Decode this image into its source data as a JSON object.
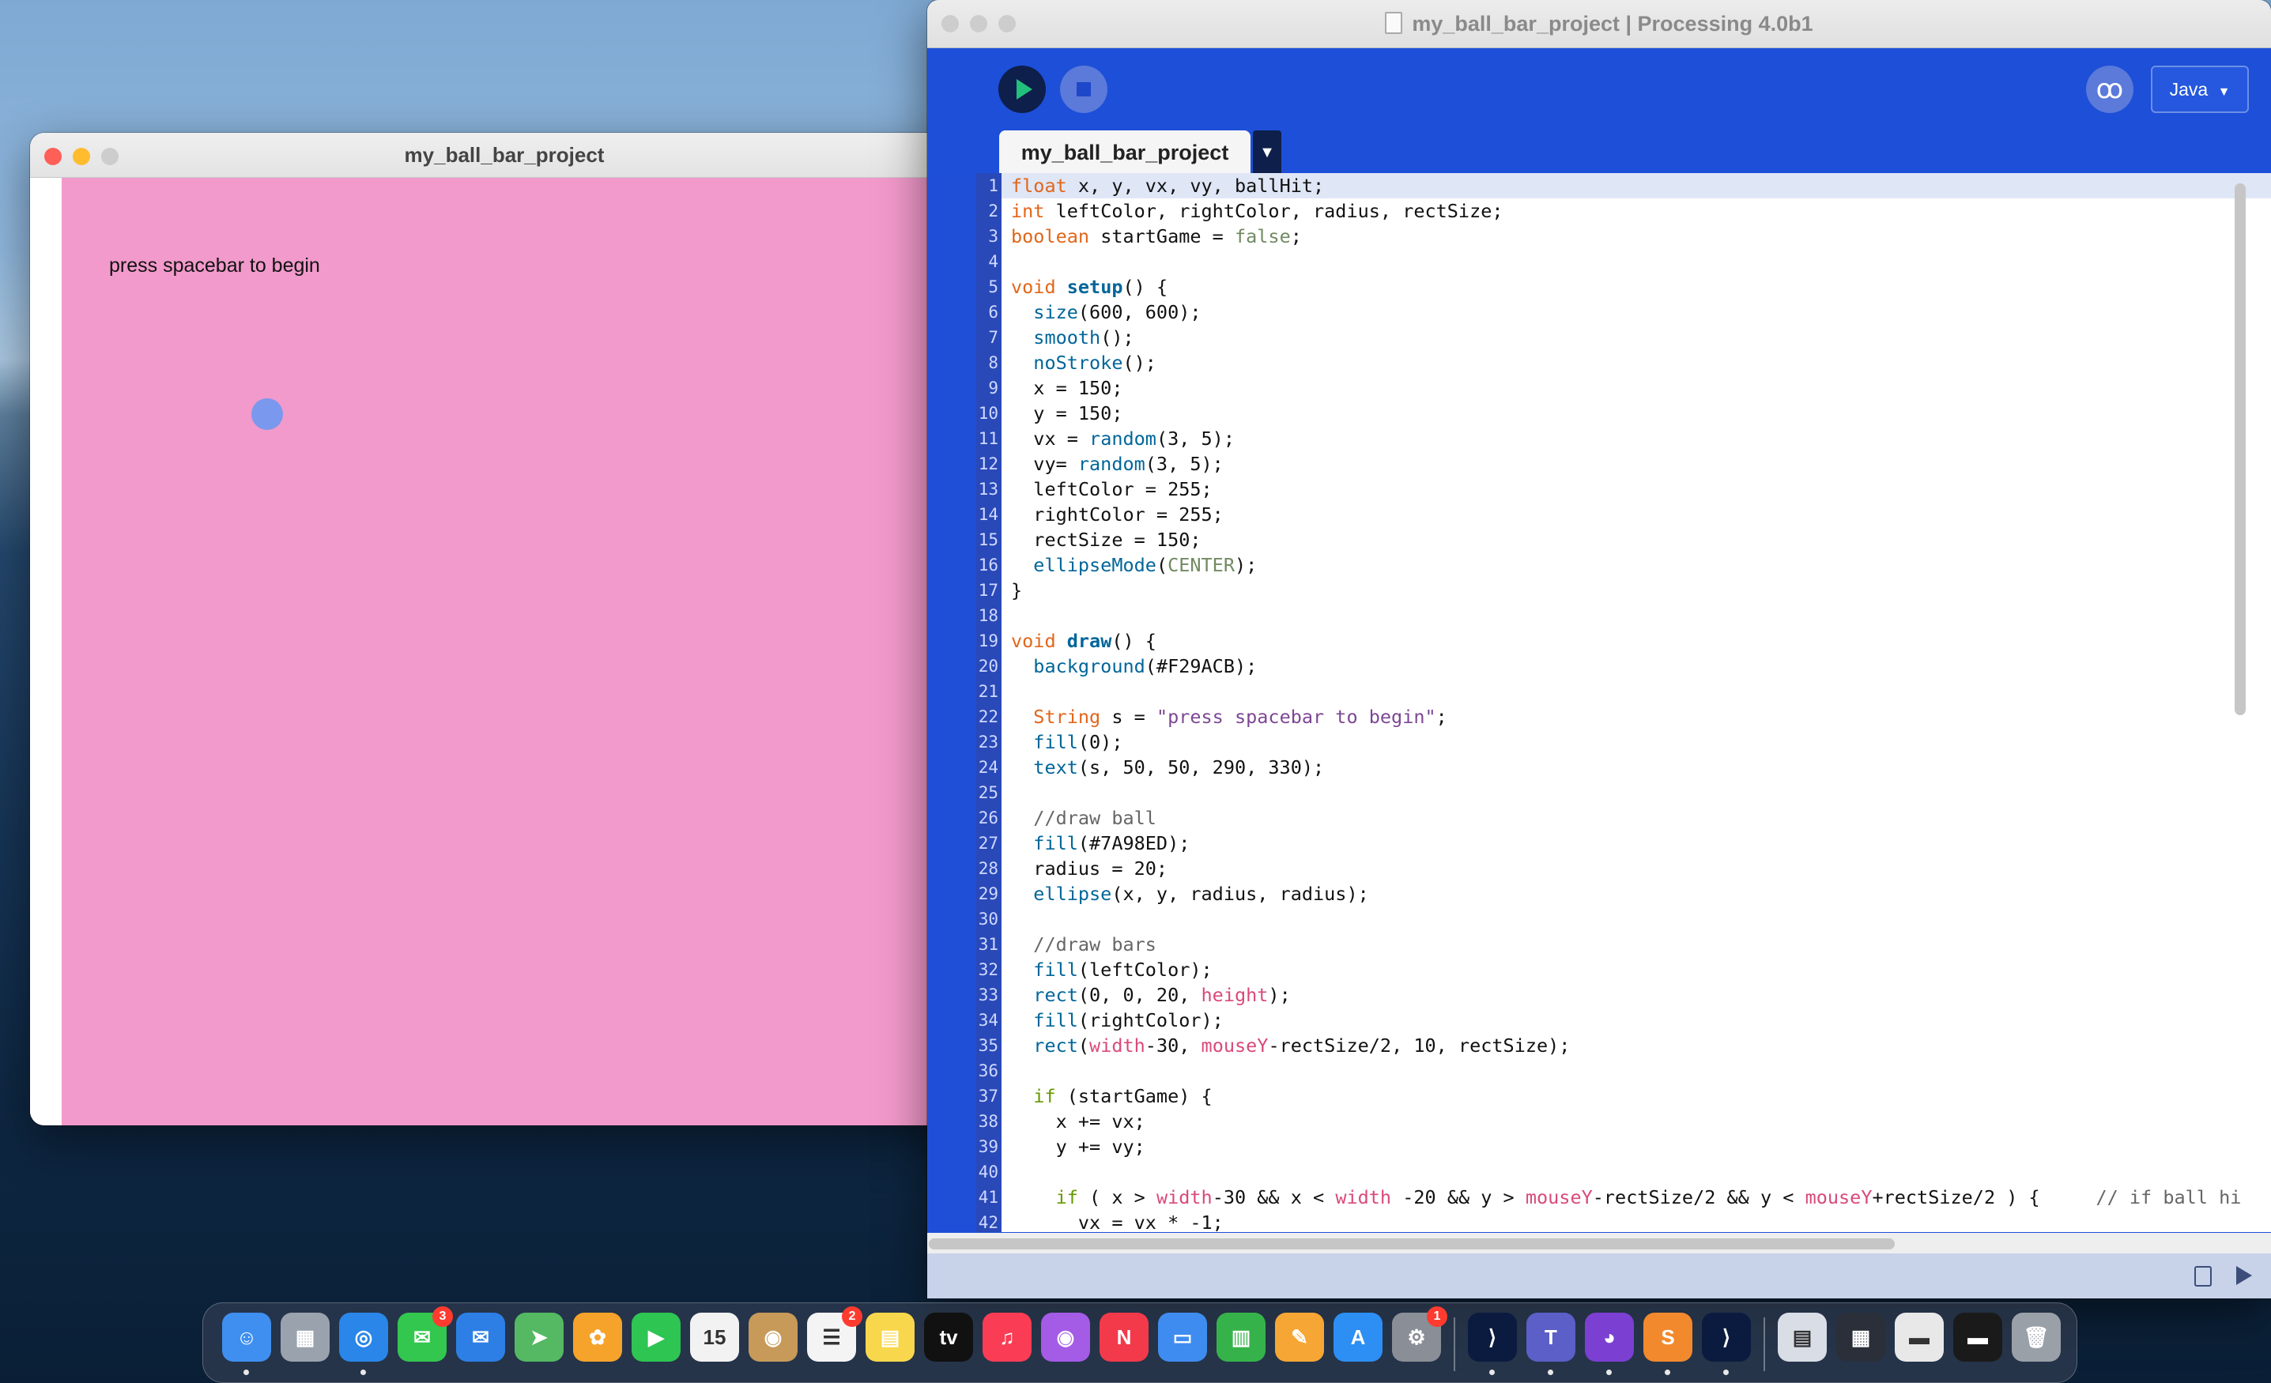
{
  "sketch_window": {
    "title": "my_ball_bar_project",
    "text": "press spacebar to begin",
    "background_color": "#F29ACB",
    "ball_color": "#7A98ED"
  },
  "ide": {
    "title": "my_ball_bar_project | Processing 4.0b1",
    "mode": "Java",
    "mode_arrow": "▼",
    "tab_label": "my_ball_bar_project",
    "tab_menu": "▼",
    "accent_color": "#1D4FD8",
    "code_lines": [
      "float x, y, vx, vy, ballHit;",
      "int leftColor, rightColor, radius, rectSize;",
      "boolean startGame = false;",
      "",
      "void setup() {",
      "  size(600, 600);",
      "  smooth();",
      "  noStroke();",
      "  x = 150;",
      "  y = 150;",
      "  vx = random(3, 5);",
      "  vy= random(3, 5);",
      "  leftColor = 255;",
      "  rightColor = 255;",
      "  rectSize = 150;",
      "  ellipseMode(CENTER);",
      "}",
      "",
      "void draw() {",
      "  background(#F29ACB);",
      "",
      "  String s = \"press spacebar to begin\";",
      "  fill(0);",
      "  text(s, 50, 50, 290, 330);",
      "",
      "  //draw ball",
      "  fill(#7A98ED);",
      "  radius = 20;",
      "  ellipse(x, y, radius, radius);",
      "",
      "  //draw bars",
      "  fill(leftColor);",
      "  rect(0, 0, 20, height);",
      "  fill(rightColor);",
      "  rect(width-30, mouseY-rectSize/2, 10, rectSize);",
      "",
      "  if (startGame) {",
      "    x += vx;",
      "    y += vy;",
      "",
      "    if ( x > width-30 && x < width -20 && y > mouseY-rectSize/2 && y < mouseY+rectSize/2 ) {     // if ball hi",
      "      vx = vx * -1;"
    ]
  },
  "dock": {
    "apps": [
      {
        "name": "finder",
        "glyph": "☺",
        "color": "#3f8ff0",
        "running": true
      },
      {
        "name": "launchpad",
        "glyph": "▦",
        "color": "#9aa3ad",
        "running": false
      },
      {
        "name": "safari",
        "glyph": "◎",
        "color": "#2a86e8",
        "running": true
      },
      {
        "name": "messages",
        "glyph": "✉",
        "color": "#33c74f",
        "running": false,
        "badge": "3"
      },
      {
        "name": "mail",
        "glyph": "✉",
        "color": "#2d7fe6",
        "running": false
      },
      {
        "name": "maps",
        "glyph": "➤",
        "color": "#54b962",
        "running": false
      },
      {
        "name": "photos",
        "glyph": "✿",
        "color": "#f6a32b",
        "running": false
      },
      {
        "name": "facetime",
        "glyph": "▶",
        "color": "#2ec552",
        "running": false
      },
      {
        "name": "calendar",
        "glyph": "15",
        "color": "#f2f2f2",
        "running": false
      },
      {
        "name": "contacts",
        "glyph": "◉",
        "color": "#c79a5a",
        "running": false
      },
      {
        "name": "reminders",
        "glyph": "☰",
        "color": "#f4f4f4",
        "running": false,
        "badge": "2"
      },
      {
        "name": "notes",
        "glyph": "▤",
        "color": "#f9d74c",
        "running": false
      },
      {
        "name": "apple-tv",
        "glyph": "tv",
        "color": "#111111",
        "running": false
      },
      {
        "name": "music",
        "glyph": "♫",
        "color": "#fa3d55",
        "running": false
      },
      {
        "name": "podcasts",
        "glyph": "◉",
        "color": "#a45be5",
        "running": false
      },
      {
        "name": "news",
        "glyph": "N",
        "color": "#f23a4b",
        "running": false
      },
      {
        "name": "keynote",
        "glyph": "▭",
        "color": "#3f8cf0",
        "running": false
      },
      {
        "name": "numbers",
        "glyph": "▥",
        "color": "#35b34a",
        "running": false
      },
      {
        "name": "pages",
        "glyph": "✎",
        "color": "#f6a635",
        "running": false
      },
      {
        "name": "app-store",
        "glyph": "A",
        "color": "#2d8ef3",
        "running": false
      },
      {
        "name": "system-preferences",
        "glyph": "⚙",
        "color": "#8a8f97",
        "running": false,
        "badge": "1"
      },
      {
        "name": "processing",
        "glyph": "⟩",
        "color": "#0b1b3f",
        "running": true
      },
      {
        "name": "teams",
        "glyph": "T",
        "color": "#5b5fc7",
        "running": true
      },
      {
        "name": "github-desktop",
        "glyph": "◕",
        "color": "#7b3fd1",
        "running": true
      },
      {
        "name": "sublime-text",
        "glyph": "S",
        "color": "#f2892c",
        "running": true
      },
      {
        "name": "processing-sketch",
        "glyph": "⟩",
        "color": "#0b1b3f",
        "running": true
      },
      {
        "name": "document-stack",
        "glyph": "▤",
        "color": "#d8dde6",
        "running": false
      },
      {
        "name": "screen-thumbnail",
        "glyph": "▦",
        "color": "#2a2f3a",
        "running": false
      },
      {
        "name": "window-thumbnail",
        "glyph": "▬",
        "color": "#e8e8e8",
        "running": false
      },
      {
        "name": "terminal-thumbnail",
        "glyph": "▬",
        "color": "#1a1a1a",
        "running": false
      },
      {
        "name": "trash",
        "glyph": "🗑",
        "color": "#9aa0a8",
        "running": false
      }
    ]
  }
}
